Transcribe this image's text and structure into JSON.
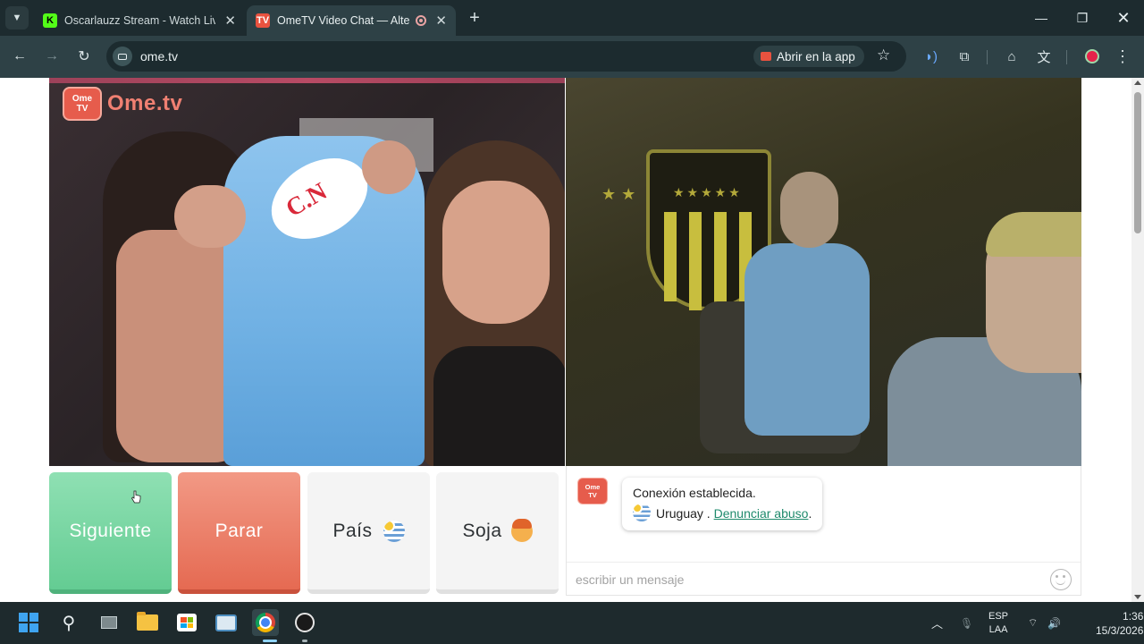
{
  "browser": {
    "tabs": [
      {
        "title": "Oscarlauzz Stream - Watch Live",
        "favicon": "kick-icon",
        "active": false
      },
      {
        "title": "OmeTV Video Chat — Alterr",
        "favicon": "ometv-icon",
        "active": true
      }
    ],
    "tab_menu_icon": "chevron-down-icon",
    "new_tab_icon": "plus-icon",
    "window": {
      "minimize_icon": "minimize-icon",
      "maximize_icon": "restore-icon",
      "close_icon": "close-icon"
    },
    "address": {
      "url": "ome.tv",
      "open_app_label": "Abrir en la app"
    },
    "toolbar_icons": [
      "bookmark-star-icon",
      "voice-icon",
      "extensions-icon",
      "incognito-icon",
      "translate-icon",
      "profile-icon",
      "menu-icon"
    ]
  },
  "ometv": {
    "logo_tv": "Ome TV",
    "logo_text": "Ome.tv",
    "logo_tv_line1": "Ome",
    "logo_tv_line2": "TV",
    "logo_word": "Ome.tv",
    "buttons": {
      "next": "Siguiente",
      "stop": "Parar",
      "country": "País",
      "gender": "Soja"
    },
    "chat": {
      "status": "Conexión establecida.",
      "country": "Uruguay .",
      "report_link": "Denunciar abuso",
      "report_suffix": ".",
      "input_placeholder": "escribir un mensaje"
    },
    "colors": {
      "next": "#6fd19c",
      "stop": "#e97560",
      "brand": "#e65c4c",
      "link": "#1f8a6c"
    }
  },
  "taskbar": {
    "apps": [
      "windows-start-icon",
      "search-icon",
      "task-view-icon",
      "file-explorer-icon",
      "microsoft-store-icon",
      "photos-icon",
      "chrome-icon",
      "obs-icon"
    ],
    "tray": {
      "lang_line1": "ESP",
      "lang_line2": "LAA",
      "time": "1:36",
      "date": "15/3/2026"
    }
  }
}
